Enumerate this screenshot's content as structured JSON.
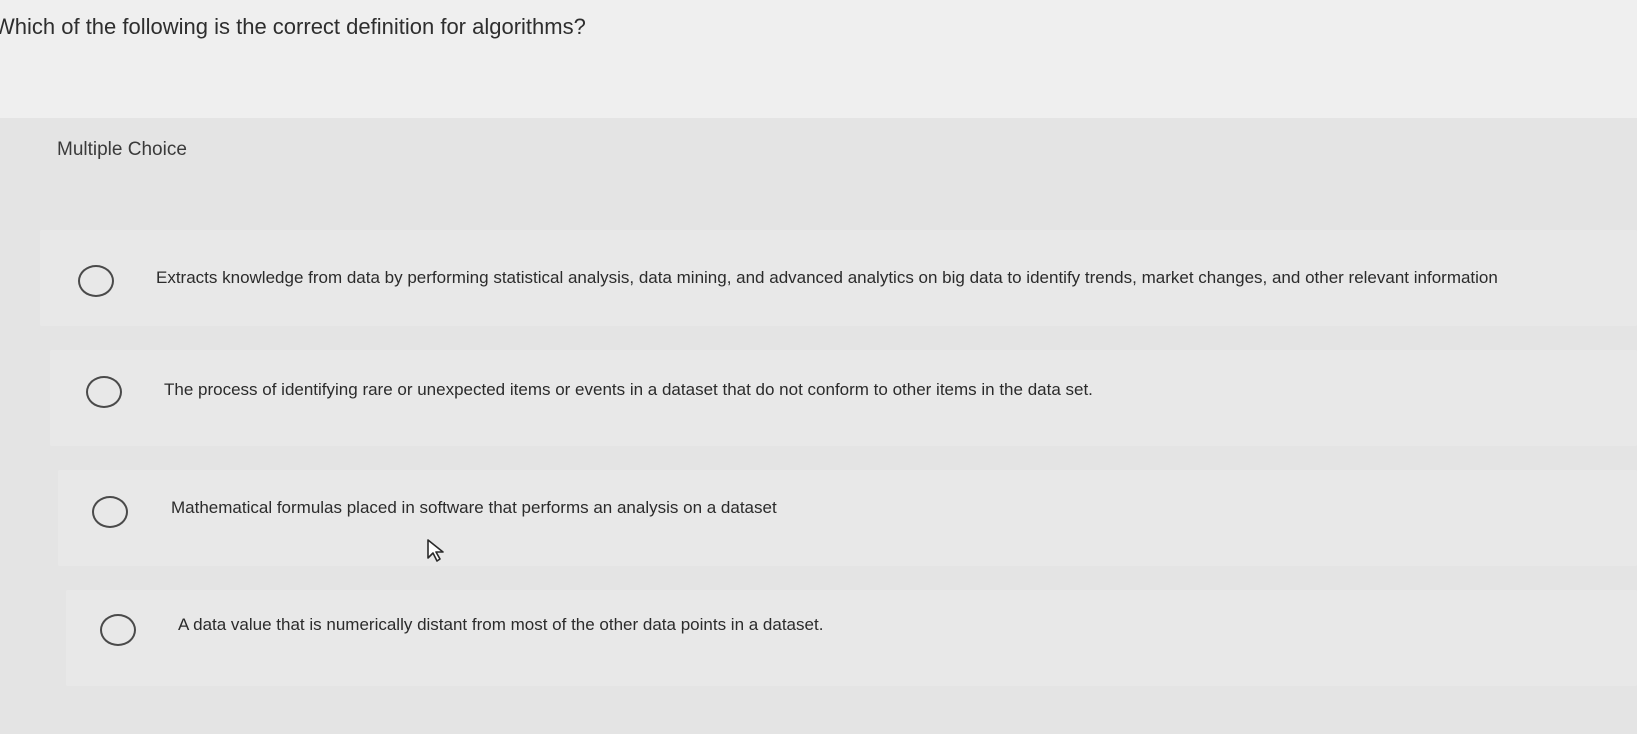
{
  "question": {
    "text": "Which of the following is the correct definition for algorithms?"
  },
  "section": {
    "label": "Multiple Choice"
  },
  "choices": [
    {
      "label": "Extracts knowledge from data by performing statistical analysis, data mining, and advanced analytics on big data to identify trends, market changes, and other relevant information"
    },
    {
      "label": "The process of identifying rare or unexpected items or events in a dataset that do not conform to other items in the data set."
    },
    {
      "label": "Mathematical formulas placed in software that performs an analysis on a dataset"
    },
    {
      "label": "A data value that is numerically distant from most of the other data points in a dataset."
    }
  ],
  "icons": {
    "radio": "radio-button-icon",
    "cursor": "mouse-pointer-icon"
  }
}
